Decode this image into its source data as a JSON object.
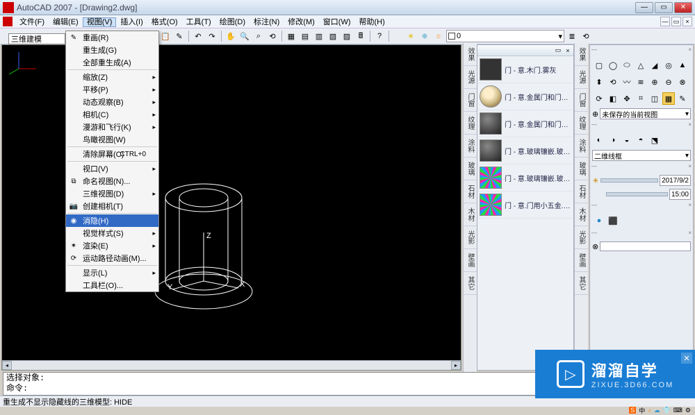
{
  "title": "AutoCAD 2007 - [Drawing2.dwg]",
  "menubar": [
    "文件(F)",
    "编辑(E)",
    "视图(V)",
    "插入(I)",
    "格式(O)",
    "工具(T)",
    "绘图(D)",
    "标注(N)",
    "修改(M)",
    "窗口(W)",
    "帮助(H)"
  ],
  "menubar_active_index": 2,
  "workspace_label": "三维建模",
  "layer_combo": "0",
  "view_menu": {
    "groups": [
      [
        {
          "label": "重画(R)",
          "icon": "✎"
        },
        {
          "label": "重生成(G)"
        },
        {
          "label": "全部重生成(A)"
        }
      ],
      [
        {
          "label": "缩放(Z)",
          "submenu": true
        },
        {
          "label": "平移(P)",
          "submenu": true
        },
        {
          "label": "动态观察(B)",
          "submenu": true
        },
        {
          "label": "相机(C)",
          "submenu": true
        },
        {
          "label": "漫游和飞行(K)",
          "submenu": true
        },
        {
          "label": "鸟瞰视图(W)"
        }
      ],
      [
        {
          "label": "清除屏幕(C)",
          "shortcut": "CTRL+0"
        }
      ],
      [
        {
          "label": "视口(V)",
          "submenu": true
        },
        {
          "label": "命名视图(N)...",
          "icon": "⧉"
        },
        {
          "label": "三维视图(D)",
          "submenu": true
        },
        {
          "label": "创建相机(T)",
          "icon": "📷"
        }
      ],
      [
        {
          "label": "消隐(H)",
          "icon": "◉",
          "selected": true
        },
        {
          "label": "视觉样式(S)",
          "submenu": true
        },
        {
          "label": "渲染(E)",
          "icon": "✶",
          "submenu": true
        },
        {
          "label": "运动路径动画(M)...",
          "icon": "⟳"
        }
      ],
      [
        {
          "label": "显示(L)",
          "submenu": true
        },
        {
          "label": "工具栏(O)..."
        }
      ]
    ]
  },
  "materials": [
    {
      "label": "门 - 意.木门.雾灰"
    },
    {
      "label": "门 - 意.金属门和门框..."
    },
    {
      "label": "门 - 意.金属门和门框..."
    },
    {
      "label": "门 - 意.玻璃镶嵌.玻璃..."
    },
    {
      "label": "门 - 意.玻璃镶嵌.玻璃..."
    },
    {
      "label": "门 - 意.门用小五金.铬..."
    }
  ],
  "vtabs": [
    "效果",
    "光源",
    "门窗",
    "纹理",
    "涂料",
    "玻璃",
    "石材",
    "木材",
    "光影",
    "壁画",
    "其它"
  ],
  "right_view_combo": "未保存的当前视图",
  "right_shade_combo": "二维线框",
  "right_date": "2017/9/2",
  "right_time": "15:00",
  "cmd_line1": "选择对象:",
  "cmd_line2": "命令:",
  "status_text": "重生成不显示隐藏线的三维模型:  HIDE",
  "ucs": {
    "x": "X",
    "y": "Y",
    "z": "Z"
  },
  "watermark": {
    "main": "溜溜自学",
    "sub": "ZIXUE.3D66.COM"
  }
}
